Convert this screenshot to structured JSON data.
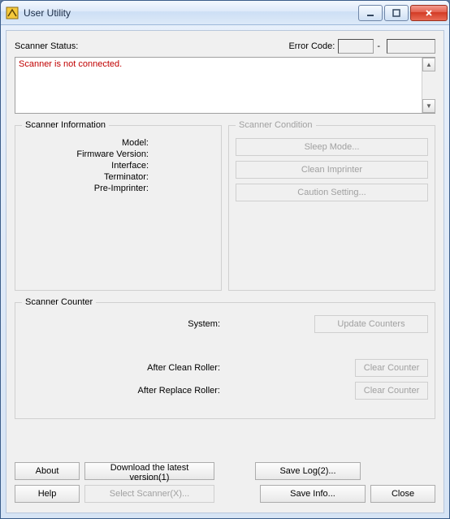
{
  "window": {
    "title": "User Utility"
  },
  "status": {
    "label": "Scanner Status:",
    "error_label": "Error Code:",
    "message": "Scanner is not connected."
  },
  "info": {
    "legend": "Scanner Information",
    "model_label": "Model:",
    "firmware_label": "Firmware Version:",
    "interface_label": "Interface:",
    "terminator_label": "Terminator:",
    "preimp_label": "Pre-Imprinter:"
  },
  "condition": {
    "legend": "Scanner Condition",
    "sleep": "Sleep Mode...",
    "clean": "Clean Imprinter",
    "caution": "Caution Setting..."
  },
  "counter": {
    "legend": "Scanner Counter",
    "system_label": "System:",
    "update": "Update Counters",
    "after_clean_label": "After Clean Roller:",
    "after_replace_label": "After Replace Roller:",
    "clear": "Clear Counter"
  },
  "buttons": {
    "about": "About",
    "download": "Download the latest version(1)",
    "savelog": "Save Log(2)...",
    "help": "Help",
    "select": "Select Scanner(X)...",
    "saveinfo": "Save Info...",
    "close": "Close"
  }
}
